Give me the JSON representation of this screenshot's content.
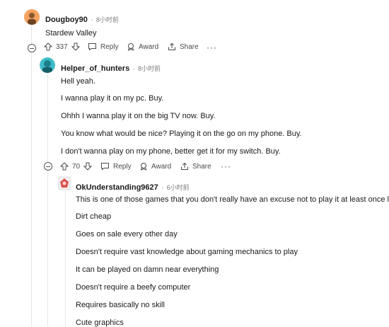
{
  "comment1": {
    "username": "Dougboy90",
    "dot": "·",
    "time": "8小时前",
    "text": "Stardew Valley",
    "votes": "337",
    "reply": "Reply",
    "award": "Award",
    "share": "Share",
    "more": "···"
  },
  "comment2": {
    "username": "Helper_of_hunters",
    "dot": "·",
    "time": "8小时前",
    "lines": [
      "Hell yeah.",
      "I wanna play it on my pc. Buy.",
      "Ohhh I wanna play it on the big TV now. Buy.",
      "You know what would be nice? Playing it on the go on my phone. Buy.",
      "I don't wanna play on my phone, better get it for my switch. Buy."
    ],
    "votes": "70",
    "reply": "Reply",
    "award": "Award",
    "share": "Share",
    "more": "···"
  },
  "comment3": {
    "username": "OkUnderstanding9627",
    "dot": "·",
    "time": "6小时前",
    "lines": [
      "This is one of those games that you don't really have an excuse not to play it at least once lmao.",
      "Dirt cheap",
      "Goes on sale every other day",
      "Doesn't require vast knowledge about gaming mechanics to play",
      "It can be played on damn near everything",
      "Doesn't require a beefy computer",
      "Requires basically no skill",
      "Cute graphics"
    ]
  },
  "colors": {
    "avatar1": "#f5a86a",
    "avatar2": "#3fbcc9",
    "avatar3": "#d9534f"
  }
}
